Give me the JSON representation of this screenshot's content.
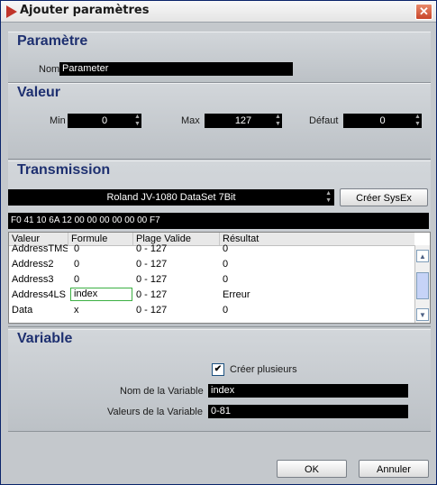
{
  "window": {
    "title": "Ajouter paramètres",
    "close_icon": "close-x-icon"
  },
  "parametre": {
    "title": "Paramètre",
    "nom_label": "Nom",
    "nom_value": "Parameter"
  },
  "valeur": {
    "title": "Valeur",
    "min_label": "Min",
    "min_value": "0",
    "max_label": "Max",
    "max_value": "127",
    "defaut_label": "Défaut",
    "defaut_value": "0"
  },
  "transmission": {
    "title": "Transmission",
    "device": "Roland JV-1080 DataSet 7Bit",
    "creer_sysex": "Créer SysEx",
    "sysex_string": "F0 41 10 6A 12 00 00 00 00 00 00 F7",
    "columns": [
      "Valeur",
      "Formule",
      "Plage Valide",
      "Résultat"
    ],
    "rows": [
      [
        "AddressTMS",
        "0",
        "0 - 127",
        "0"
      ],
      [
        "Address2",
        "0",
        "0 - 127",
        "0"
      ],
      [
        "Address3",
        "0",
        "0 - 127",
        "0"
      ],
      [
        "Address4LS",
        "index",
        "0 - 127",
        "Erreur"
      ],
      [
        "Data",
        "x",
        "0 - 127",
        "0"
      ]
    ]
  },
  "variable": {
    "title": "Variable",
    "creer_plusieurs": "Créer plusieurs",
    "nom_label": "Nom de la Variable",
    "nom_value": "index",
    "valeurs_label": "Valeurs de la Variable",
    "valeurs_value": "0-81"
  },
  "buttons": {
    "ok": "OK",
    "annuler": "Annuler"
  }
}
